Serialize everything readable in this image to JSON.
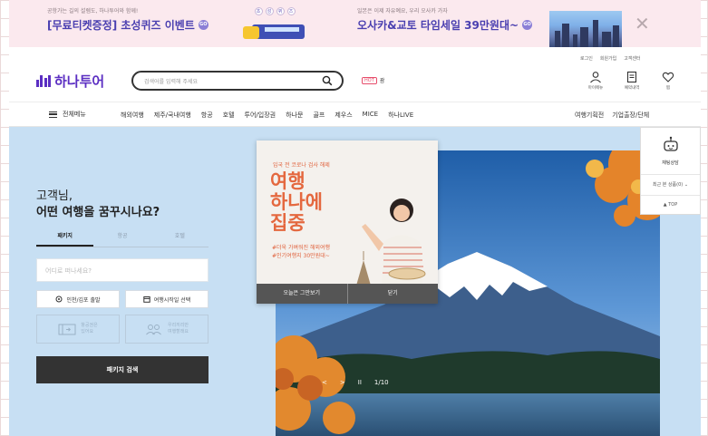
{
  "top_banner": {
    "ad1_small": "공항가는 길의 설렘도, 하나투어와 함께!",
    "ad1_title": "[무료티켓증정] 초성퀴즈 이벤트",
    "coupon_letters": [
      "초",
      "성",
      "퀴",
      "즈"
    ],
    "ad2_small": "일본은 이제 자유예요, 우리 오사카 가자",
    "ad2_title": "오사카&교토 타임세일 39만원대~",
    "go_label": "GO",
    "close_icon": "close-icon"
  },
  "header": {
    "logo_text": "하나투어",
    "search_placeholder": "검색어를 입력해 주세요",
    "hot_badge": "HOT",
    "hot_word": "괌",
    "util_links": [
      "로그인",
      "회원가입",
      "고객센터"
    ],
    "icons": [
      {
        "label": "마이메뉴",
        "icon": "user-icon"
      },
      {
        "label": "예약내역",
        "icon": "document-icon"
      },
      {
        "label": "찜",
        "icon": "heart-icon"
      }
    ]
  },
  "gnb": {
    "all_menu": "전체메뉴",
    "items": [
      "해외여행",
      "제주/국내여행",
      "항공",
      "호텔",
      "투어/입장권",
      "하나문",
      "골프",
      "제우스",
      "MICE",
      "하나LIVE"
    ],
    "right": [
      "여행기획전",
      "기업출장/단체"
    ]
  },
  "hero": {
    "greeting_line1": "고객님,",
    "greeting_line2": "어떤 여행을 꿈꾸시나요?",
    "tabs": [
      {
        "label": "패키지",
        "active": true
      },
      {
        "label": "항공",
        "active": false
      },
      {
        "label": "호텔",
        "active": false
      }
    ],
    "destination_placeholder": "어디로 떠나세요?",
    "departure_btn": "인천/김포 출발",
    "date_btn": "여행시작일 선택",
    "option1": [
      "항공권은",
      "있어요"
    ],
    "option2": [
      "우리끼리만",
      "여행할래요"
    ],
    "search_button": "패키지 검색",
    "slide_counter": "1/10",
    "slide_prev": "<",
    "slide_next": ">",
    "slide_pause": "II"
  },
  "popup": {
    "subtitle": "입국 전 코로나 검사 해제",
    "title_line1": "여행",
    "title_line2": "하나에",
    "title_line3": "집중",
    "tag1": "#더욱 가벼워진 해외여행",
    "tag2": "#인기여행지 30만원대~",
    "btn_today": "오늘은 그만보기",
    "btn_close": "닫기"
  },
  "right_float": {
    "chat_label": "채팅상담",
    "recent_label": "최근 본 상품(0)",
    "top_label": "TOP"
  },
  "colors": {
    "brand": "#5b2ec2",
    "banner_bg": "#fbe9ee",
    "hero_bg": "#c7dff3",
    "popup_accent": "#e4683f"
  }
}
